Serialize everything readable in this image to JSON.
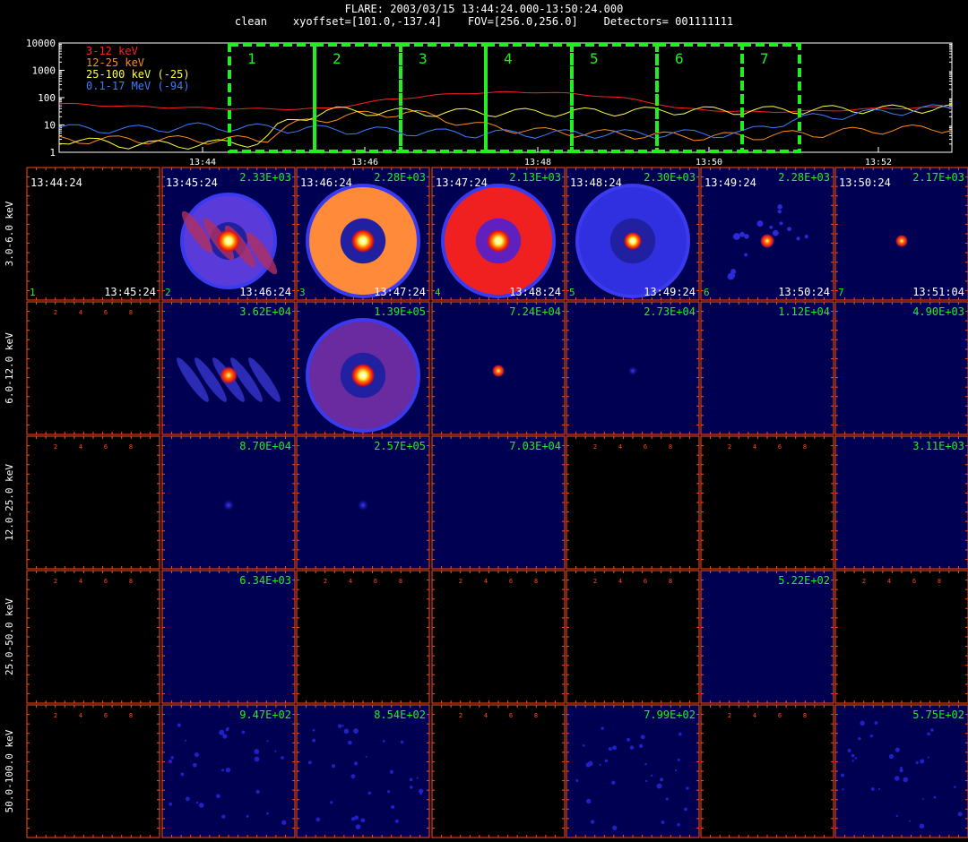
{
  "title": "FLARE: 2003/03/15 13:44:24.000-13:50:24.000",
  "subtitle": "clean    xyoffset=[101.0,-137.4]    FOV=[256.0,256.0]    Detectors= 001111111",
  "colors": {
    "band1": "#ff2020",
    "band2": "#ff8c1a",
    "band3": "#ffff40",
    "band4": "#3c7dff",
    "intervals": "#22ee22",
    "grid": "#ff4a1a",
    "labels": "#22ee22"
  },
  "chart_data": [
    {
      "type": "line",
      "name": "lightcurve",
      "ylog": true,
      "ylim": [
        1,
        10000
      ],
      "y_ticks": [
        "1",
        "10",
        "100",
        "1000",
        "10000"
      ],
      "xlim": [
        13.3,
        13.9
      ],
      "x_ticks": [
        "13:44",
        "13:46",
        "13:48",
        "13:50",
        "13:52"
      ],
      "x_tick_vals": [
        13.44,
        13.46,
        13.48,
        13.5,
        13.52
      ],
      "x": [
        13.41,
        13.42,
        13.43,
        13.44,
        13.45,
        13.46,
        13.47,
        13.48,
        13.49,
        13.5,
        13.51,
        13.52,
        13.53,
        13.54
      ],
      "series": [
        {
          "name": "3-12 keV",
          "color": "#ff2020",
          "values": [
            60,
            48,
            42,
            38,
            40,
            95,
            150,
            160,
            110,
            40,
            30,
            32,
            40,
            45
          ]
        },
        {
          "name": "12-25 keV",
          "color": "#ff8c1a",
          "values": [
            3,
            3,
            3,
            3,
            20,
            30,
            10,
            6,
            5,
            4,
            4,
            5,
            7,
            8
          ]
        },
        {
          "name": "25-100 keV (-25)",
          "color": "#ffff40",
          "values": [
            3,
            2,
            2,
            2.5,
            35,
            30,
            30,
            30,
            32,
            35,
            35,
            38,
            40,
            42
          ]
        },
        {
          "name": "0.1-17 MeV (-94)",
          "color": "#3c7dff",
          "values": [
            8,
            7,
            9,
            8,
            7,
            6,
            5,
            5,
            5,
            5,
            5,
            20,
            30,
            45
          ]
        }
      ],
      "intervals": [
        {
          "label": "1",
          "start": 13.454,
          "end": 13.464
        },
        {
          "label": "2",
          "start": 13.464,
          "end": 13.474
        },
        {
          "label": "3",
          "start": 13.474,
          "end": 13.484
        },
        {
          "label": "4",
          "start": 13.484,
          "end": 13.494
        },
        {
          "label": "5",
          "start": 13.494,
          "end": 13.504
        },
        {
          "label": "6",
          "start": 13.504,
          "end": 13.514
        },
        {
          "label": "7",
          "start": 13.514,
          "end": 13.5104
        }
      ]
    },
    {
      "type": "heatmap",
      "name": "image-grid",
      "bands": [
        "3.0-6.0 keV",
        "6.0-12.0 keV",
        "12.0-25.0 keV",
        "25.0-50.0 keV",
        "50.0-100.0 keV"
      ],
      "col_start_times": [
        "13:44:24",
        "13:45:24",
        "13:46:24",
        "13:47:24",
        "13:48:24",
        "13:49:24",
        "13:50:24"
      ],
      "col_end_times": [
        "13:45:24",
        "13:46:24",
        "13:47:24",
        "13:48:24",
        "13:49:24",
        "13:50:24",
        "13:51:04"
      ],
      "col_numbers": [
        "1",
        "2",
        "3",
        "4",
        "5",
        "6",
        "7"
      ],
      "axis_ticks": [
        "2",
        "4",
        "6",
        "8"
      ],
      "cells": [
        [
          {
            "kind": "empty"
          },
          {
            "kind": "ringbars",
            "peak": "2.33E+03"
          },
          {
            "kind": "ring",
            "peak": "2.28E+03"
          },
          {
            "kind": "ringred",
            "peak": "2.13E+03"
          },
          {
            "kind": "ringblue",
            "peak": "2.30E+03"
          },
          {
            "kind": "spots",
            "peak": "2.28E+03"
          },
          {
            "kind": "dot",
            "peak": "2.17E+03"
          }
        ],
        [
          {
            "kind": "empty"
          },
          {
            "kind": "bars",
            "peak": "3.62E+04"
          },
          {
            "kind": "ringpurple",
            "peak": "1.39E+05"
          },
          {
            "kind": "small",
            "peak": "7.24E+04"
          },
          {
            "kind": "tiny",
            "peak": "2.73E+04"
          },
          {
            "kind": "blank",
            "peak": "1.12E+04"
          },
          {
            "kind": "blank",
            "peak": "4.90E+03"
          }
        ],
        [
          {
            "kind": "empty"
          },
          {
            "kind": "blob",
            "peak": "8.70E+04"
          },
          {
            "kind": "blob",
            "peak": "2.57E+05"
          },
          {
            "kind": "blank",
            "peak": "7.03E+04"
          },
          {
            "kind": "empty"
          },
          {
            "kind": "empty"
          },
          {
            "kind": "blank",
            "peak": "3.11E+03"
          }
        ],
        [
          {
            "kind": "empty"
          },
          {
            "kind": "blank",
            "peak": "6.34E+03"
          },
          {
            "kind": "empty"
          },
          {
            "kind": "empty"
          },
          {
            "kind": "empty"
          },
          {
            "kind": "blank",
            "peak": "5.22E+02"
          },
          {
            "kind": "empty"
          }
        ],
        [
          {
            "kind": "empty"
          },
          {
            "kind": "noise",
            "peak": "9.47E+02"
          },
          {
            "kind": "noise",
            "peak": "8.54E+02"
          },
          {
            "kind": "empty"
          },
          {
            "kind": "noise",
            "peak": "7.99E+02"
          },
          {
            "kind": "empty"
          },
          {
            "kind": "noise",
            "peak": "5.75E+02"
          }
        ]
      ]
    }
  ]
}
